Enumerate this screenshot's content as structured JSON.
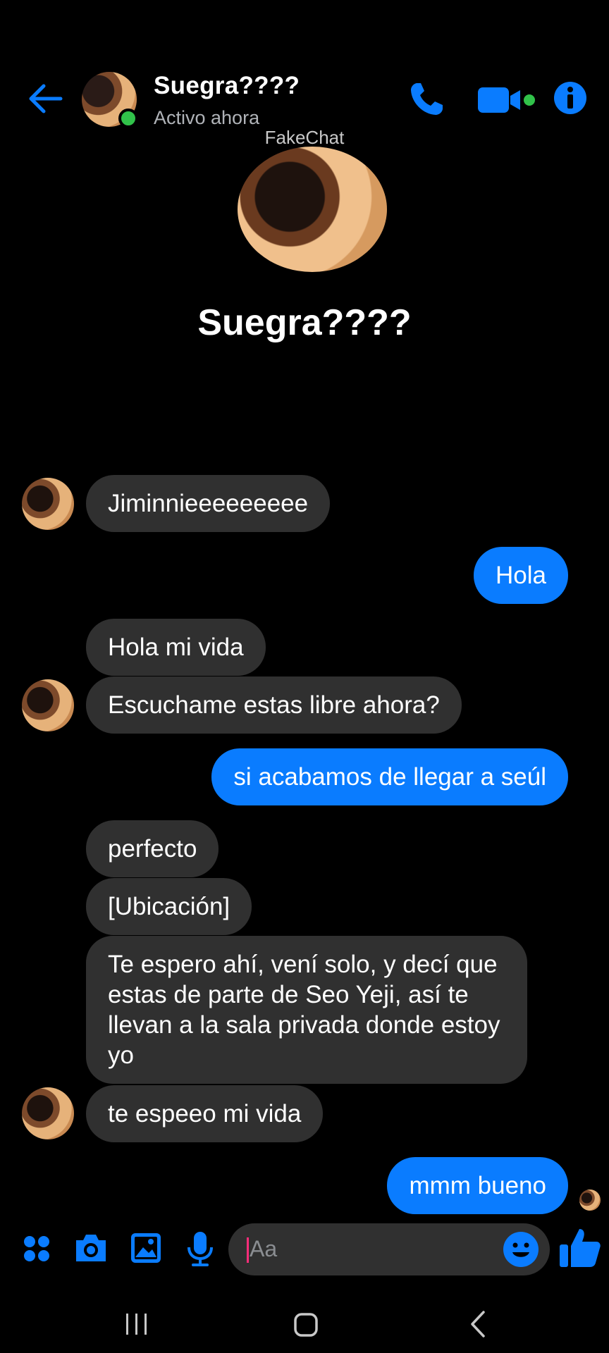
{
  "header": {
    "contact_name": "Suegra????",
    "status": "Activo ahora"
  },
  "watermark": "FakeChat",
  "profile": {
    "name": "Suegra????"
  },
  "messages": [
    {
      "side": "in",
      "text": "Jiminnieeeeeeeee"
    },
    {
      "side": "out",
      "text": "Hola"
    },
    {
      "side": "in",
      "text": "Hola mi vida"
    },
    {
      "side": "in",
      "text": "Escuchame estas libre ahora?"
    },
    {
      "side": "out",
      "text": "si acabamos de llegar a seúl"
    },
    {
      "side": "in",
      "text": "perfecto"
    },
    {
      "side": "in",
      "text": "[Ubicación]"
    },
    {
      "side": "in",
      "text": "Te espero ahí, vení solo, y decí que estas de parte de Seo Yeji, así te llevan a la sala privada donde estoy yo"
    },
    {
      "side": "in",
      "text": "te espeeo mi vida"
    },
    {
      "side": "out",
      "text": "mmm bueno"
    }
  ],
  "composer": {
    "placeholder": "Aa"
  },
  "colors": {
    "accent": "#0a7cff",
    "incoming_bubble": "#303030",
    "online": "#31c24a",
    "background": "#000000"
  },
  "icons": [
    "back-arrow-icon",
    "phone-icon",
    "video-camera-icon",
    "info-icon",
    "apps-icon",
    "camera-icon",
    "gallery-icon",
    "microphone-icon",
    "emoji-icon",
    "thumbs-up-icon",
    "recent-apps-icon",
    "home-icon",
    "nav-back-icon"
  ]
}
